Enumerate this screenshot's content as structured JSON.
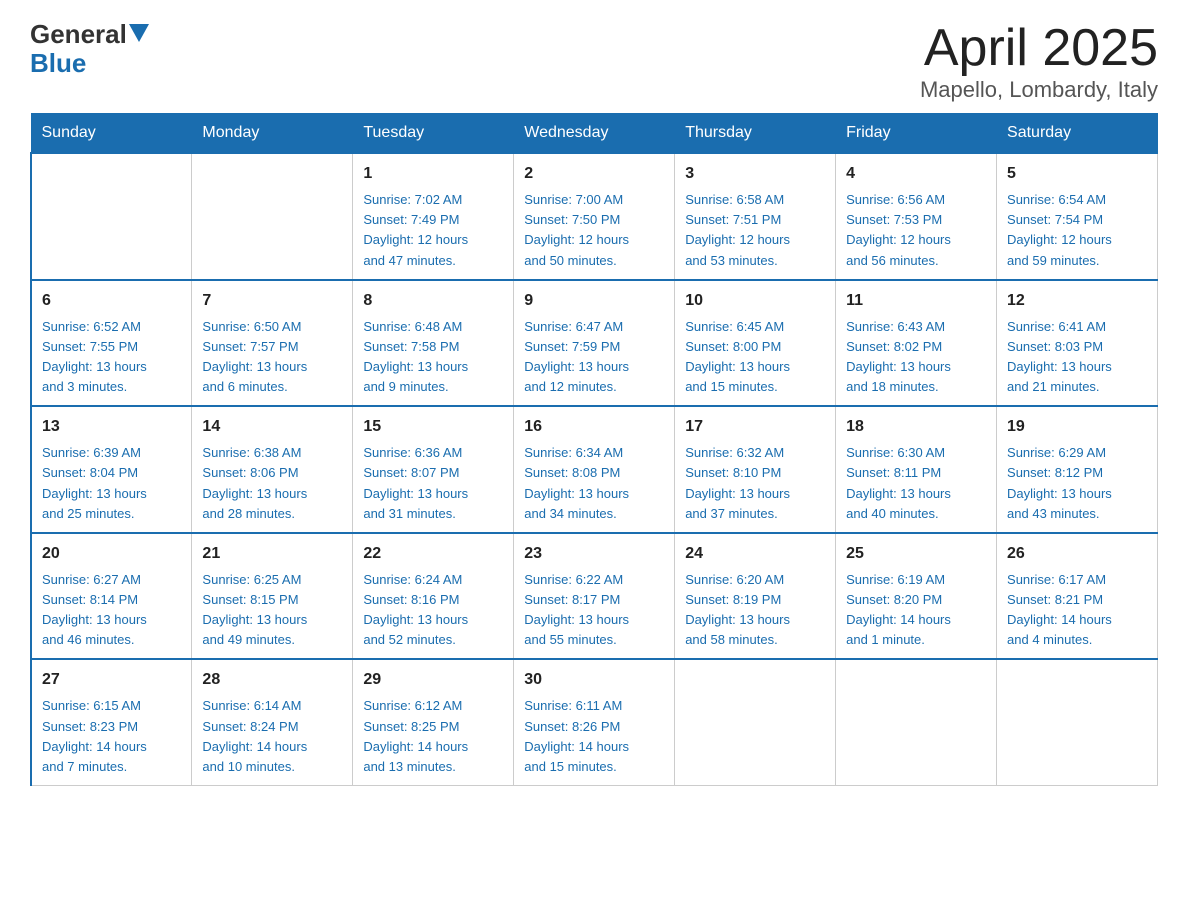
{
  "header": {
    "logo_general": "General",
    "logo_blue": "Blue",
    "title": "April 2025",
    "subtitle": "Mapello, Lombardy, Italy"
  },
  "days_of_week": [
    "Sunday",
    "Monday",
    "Tuesday",
    "Wednesday",
    "Thursday",
    "Friday",
    "Saturday"
  ],
  "weeks": [
    [
      {
        "day": "",
        "info": ""
      },
      {
        "day": "",
        "info": ""
      },
      {
        "day": "1",
        "info": "Sunrise: 7:02 AM\nSunset: 7:49 PM\nDaylight: 12 hours\nand 47 minutes."
      },
      {
        "day": "2",
        "info": "Sunrise: 7:00 AM\nSunset: 7:50 PM\nDaylight: 12 hours\nand 50 minutes."
      },
      {
        "day": "3",
        "info": "Sunrise: 6:58 AM\nSunset: 7:51 PM\nDaylight: 12 hours\nand 53 minutes."
      },
      {
        "day": "4",
        "info": "Sunrise: 6:56 AM\nSunset: 7:53 PM\nDaylight: 12 hours\nand 56 minutes."
      },
      {
        "day": "5",
        "info": "Sunrise: 6:54 AM\nSunset: 7:54 PM\nDaylight: 12 hours\nand 59 minutes."
      }
    ],
    [
      {
        "day": "6",
        "info": "Sunrise: 6:52 AM\nSunset: 7:55 PM\nDaylight: 13 hours\nand 3 minutes."
      },
      {
        "day": "7",
        "info": "Sunrise: 6:50 AM\nSunset: 7:57 PM\nDaylight: 13 hours\nand 6 minutes."
      },
      {
        "day": "8",
        "info": "Sunrise: 6:48 AM\nSunset: 7:58 PM\nDaylight: 13 hours\nand 9 minutes."
      },
      {
        "day": "9",
        "info": "Sunrise: 6:47 AM\nSunset: 7:59 PM\nDaylight: 13 hours\nand 12 minutes."
      },
      {
        "day": "10",
        "info": "Sunrise: 6:45 AM\nSunset: 8:00 PM\nDaylight: 13 hours\nand 15 minutes."
      },
      {
        "day": "11",
        "info": "Sunrise: 6:43 AM\nSunset: 8:02 PM\nDaylight: 13 hours\nand 18 minutes."
      },
      {
        "day": "12",
        "info": "Sunrise: 6:41 AM\nSunset: 8:03 PM\nDaylight: 13 hours\nand 21 minutes."
      }
    ],
    [
      {
        "day": "13",
        "info": "Sunrise: 6:39 AM\nSunset: 8:04 PM\nDaylight: 13 hours\nand 25 minutes."
      },
      {
        "day": "14",
        "info": "Sunrise: 6:38 AM\nSunset: 8:06 PM\nDaylight: 13 hours\nand 28 minutes."
      },
      {
        "day": "15",
        "info": "Sunrise: 6:36 AM\nSunset: 8:07 PM\nDaylight: 13 hours\nand 31 minutes."
      },
      {
        "day": "16",
        "info": "Sunrise: 6:34 AM\nSunset: 8:08 PM\nDaylight: 13 hours\nand 34 minutes."
      },
      {
        "day": "17",
        "info": "Sunrise: 6:32 AM\nSunset: 8:10 PM\nDaylight: 13 hours\nand 37 minutes."
      },
      {
        "day": "18",
        "info": "Sunrise: 6:30 AM\nSunset: 8:11 PM\nDaylight: 13 hours\nand 40 minutes."
      },
      {
        "day": "19",
        "info": "Sunrise: 6:29 AM\nSunset: 8:12 PM\nDaylight: 13 hours\nand 43 minutes."
      }
    ],
    [
      {
        "day": "20",
        "info": "Sunrise: 6:27 AM\nSunset: 8:14 PM\nDaylight: 13 hours\nand 46 minutes."
      },
      {
        "day": "21",
        "info": "Sunrise: 6:25 AM\nSunset: 8:15 PM\nDaylight: 13 hours\nand 49 minutes."
      },
      {
        "day": "22",
        "info": "Sunrise: 6:24 AM\nSunset: 8:16 PM\nDaylight: 13 hours\nand 52 minutes."
      },
      {
        "day": "23",
        "info": "Sunrise: 6:22 AM\nSunset: 8:17 PM\nDaylight: 13 hours\nand 55 minutes."
      },
      {
        "day": "24",
        "info": "Sunrise: 6:20 AM\nSunset: 8:19 PM\nDaylight: 13 hours\nand 58 minutes."
      },
      {
        "day": "25",
        "info": "Sunrise: 6:19 AM\nSunset: 8:20 PM\nDaylight: 14 hours\nand 1 minute."
      },
      {
        "day": "26",
        "info": "Sunrise: 6:17 AM\nSunset: 8:21 PM\nDaylight: 14 hours\nand 4 minutes."
      }
    ],
    [
      {
        "day": "27",
        "info": "Sunrise: 6:15 AM\nSunset: 8:23 PM\nDaylight: 14 hours\nand 7 minutes."
      },
      {
        "day": "28",
        "info": "Sunrise: 6:14 AM\nSunset: 8:24 PM\nDaylight: 14 hours\nand 10 minutes."
      },
      {
        "day": "29",
        "info": "Sunrise: 6:12 AM\nSunset: 8:25 PM\nDaylight: 14 hours\nand 13 minutes."
      },
      {
        "day": "30",
        "info": "Sunrise: 6:11 AM\nSunset: 8:26 PM\nDaylight: 14 hours\nand 15 minutes."
      },
      {
        "day": "",
        "info": ""
      },
      {
        "day": "",
        "info": ""
      },
      {
        "day": "",
        "info": ""
      }
    ]
  ]
}
